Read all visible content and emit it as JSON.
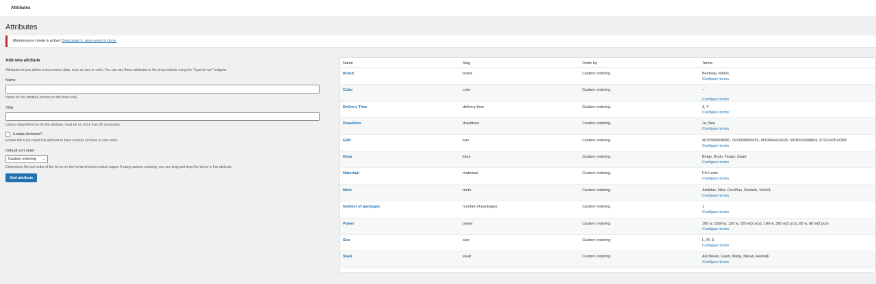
{
  "topbar": {
    "title": "Attributes"
  },
  "page": {
    "title": "Attributes"
  },
  "notice": {
    "text": "Maintenance mode is active!",
    "link": "Deactivate it, when work is done."
  },
  "form": {
    "heading": "Add new attribute",
    "intro": "Attributes let you define extra product data, such as size or color. You can use these attributes in the shop sidebar using the \"layered nav\" widgets.",
    "name_label": "Name",
    "name_value": "",
    "name_help": "Name for the attribute (shown on the front-end).",
    "slug_label": "Slug",
    "slug_value": "",
    "slug_help": "Unique slug/reference for the attribute; must be no more than 28 characters.",
    "archives_label": "Enable Archives?",
    "archives_help": "Enable this if you want this attribute to have product archives in your store.",
    "sort_label": "Default sort order",
    "sort_value": "Custom ordering",
    "sort_help": "Determines the sort order of the terms on the frontend shop product pages. If using custom ordering, you can drag and drop the terms in this attribute.",
    "submit": "Add attribute"
  },
  "table": {
    "headers": {
      "name": "Name",
      "slug": "Slug",
      "order": "Order by",
      "terms": "Terms"
    },
    "configure": "Configure terms",
    "rows": [
      {
        "name": "Brand",
        "slug": "brand",
        "order": "Custom ordering",
        "terms": "Bestway, vidaXL"
      },
      {
        "name": "Color",
        "slug": "color",
        "order": "Custom ordering",
        "terms": "–"
      },
      {
        "name": "Delivery Time",
        "slug": "delivery-time",
        "order": "Custom ordering",
        "terms": "3, 4"
      },
      {
        "name": "Draadloos",
        "slug": "draadloos",
        "order": "Custom ordering",
        "terms": "Ja, Nee"
      },
      {
        "name": "EAN",
        "slug": "ean",
        "order": "Custom ordering",
        "terms": "4015588404586, 7424938085053, 8593844204126, 5904555008804, 8720143514388"
      },
      {
        "name": "Kleur",
        "slug": "kleur",
        "order": "Custom ordering",
        "terms": "Beige, Bruin, Taupe, Zwart"
      },
      {
        "name": "Materiaal",
        "slug": "materiaal",
        "order": "Custom ordering",
        "terms": "PU Leder"
      },
      {
        "name": "Merk",
        "slug": "merk",
        "order": "Custom ordering",
        "terms": "Addidas, Nike, OnePlus, Reebok, VidaXL"
      },
      {
        "name": "Number of packages",
        "slug": "number-of-packages",
        "order": "Custom ordering",
        "terms": "1"
      },
      {
        "name": "Power",
        "slug": "power",
        "order": "Custom ordering",
        "terms": "100 w, 1000 w, 120 w, 120 w(2 pcs), 180 w, 360 w(2 pcs), 80 w, 80 w(2 pcs)"
      },
      {
        "name": "Size",
        "slug": "size",
        "order": "Custom ordering",
        "terms": "L, M, S"
      },
      {
        "name": "Staat",
        "slug": "staat",
        "order": "Custom ordering",
        "terms": "Als Nieuw, Goed, Matig, Nieuw, Redelijk"
      }
    ]
  },
  "colors": {
    "accent": "#2271b1",
    "notice_border": "#b32d2e"
  }
}
